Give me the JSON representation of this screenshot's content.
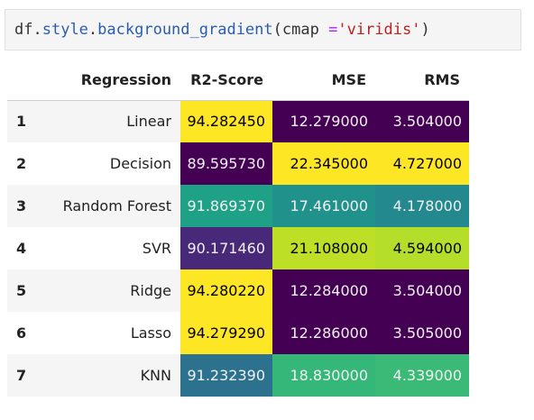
{
  "code": {
    "prefix": "df",
    "dot1": ".",
    "attr1": "style",
    "dot2": ".",
    "attr2": "background_gradient",
    "open": "(",
    "arg": "cmap ",
    "op": "=",
    "str": "'viridis'",
    "close": ")"
  },
  "table": {
    "headers": [
      "",
      "Regression",
      "R2-Score",
      "MSE",
      "RMS"
    ],
    "rows": [
      {
        "index": "1",
        "regression": "Linear",
        "r2": "94.282450",
        "mse": "12.279000",
        "rms": "3.504000",
        "colors": {
          "r2": {
            "bg": "#fde725",
            "fg": "#000000"
          },
          "mse": {
            "bg": "#440154",
            "fg": "#f1f1f1"
          },
          "rms": {
            "bg": "#440154",
            "fg": "#f1f1f1"
          }
        }
      },
      {
        "index": "2",
        "regression": "Decision",
        "r2": "89.595730",
        "mse": "22.345000",
        "rms": "4.727000",
        "colors": {
          "r2": {
            "bg": "#440154",
            "fg": "#f1f1f1"
          },
          "mse": {
            "bg": "#fde725",
            "fg": "#000000"
          },
          "rms": {
            "bg": "#fde725",
            "fg": "#000000"
          }
        }
      },
      {
        "index": "3",
        "regression": "Random Forest",
        "r2": "91.869370",
        "mse": "17.461000",
        "rms": "4.178000",
        "colors": {
          "r2": {
            "bg": "#1fa187",
            "fg": "#f1f1f1"
          },
          "mse": {
            "bg": "#21918c",
            "fg": "#f1f1f1"
          },
          "rms": {
            "bg": "#23898e",
            "fg": "#f1f1f1"
          }
        }
      },
      {
        "index": "4",
        "regression": "SVR",
        "r2": "90.171460",
        "mse": "21.108000",
        "rms": "4.594000",
        "colors": {
          "r2": {
            "bg": "#482878",
            "fg": "#f1f1f1"
          },
          "mse": {
            "bg": "#bddf26",
            "fg": "#000000"
          },
          "rms": {
            "bg": "#b5de2b",
            "fg": "#000000"
          }
        }
      },
      {
        "index": "5",
        "regression": "Ridge",
        "r2": "94.280220",
        "mse": "12.284000",
        "rms": "3.504000",
        "colors": {
          "r2": {
            "bg": "#fde725",
            "fg": "#000000"
          },
          "mse": {
            "bg": "#440154",
            "fg": "#f1f1f1"
          },
          "rms": {
            "bg": "#440154",
            "fg": "#f1f1f1"
          }
        }
      },
      {
        "index": "6",
        "regression": "Lasso",
        "r2": "94.279290",
        "mse": "12.286000",
        "rms": "3.505000",
        "colors": {
          "r2": {
            "bg": "#fde725",
            "fg": "#000000"
          },
          "mse": {
            "bg": "#440154",
            "fg": "#f1f1f1"
          },
          "rms": {
            "bg": "#440154",
            "fg": "#f1f1f1"
          }
        }
      },
      {
        "index": "7",
        "regression": "KNN",
        "r2": "91.232390",
        "mse": "18.830000",
        "rms": "4.339000",
        "colors": {
          "r2": {
            "bg": "#2c728e",
            "fg": "#f1f1f1"
          },
          "mse": {
            "bg": "#35b779",
            "fg": "#f1f1f1"
          },
          "rms": {
            "bg": "#3aba76",
            "fg": "#f1f1f1"
          }
        }
      }
    ]
  }
}
